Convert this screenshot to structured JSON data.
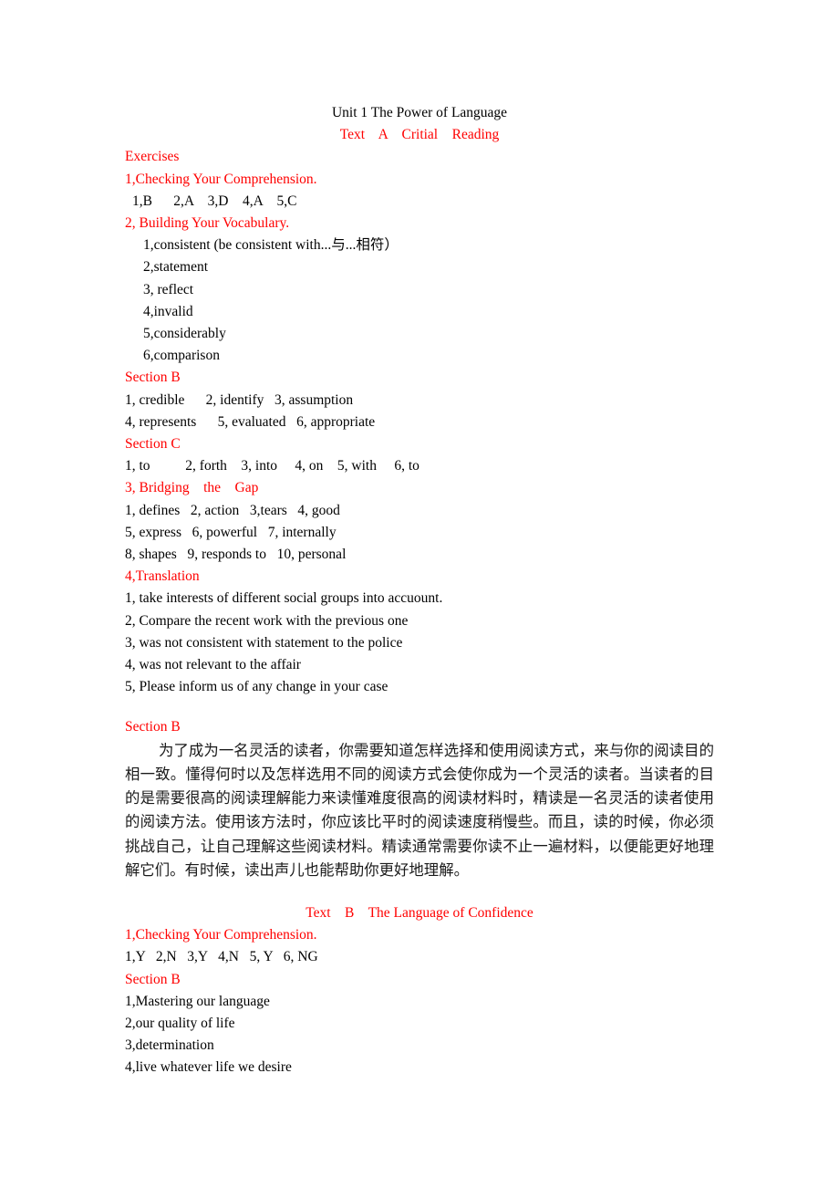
{
  "document": {
    "title": "Unit 1 The Power of Language",
    "subtitle": "Text    A    Critial    Reading",
    "colors": {
      "heading_red": "#ff0000",
      "body_black": "#000000",
      "page_background": "#ffffff"
    }
  },
  "text_a": {
    "exercises_heading": "Exercises",
    "section_1": {
      "heading": "1,Checking Your Comprehension.",
      "answers": "1,B      2,A    3,D    4,A    5,C"
    },
    "section_2": {
      "heading": "2, Building Your Vocabulary.",
      "items": [
        "1,consistent (be consistent with...与...相符）",
        "2,statement",
        "3, reflect",
        "4,invalid",
        "5,considerably",
        "6,comparison"
      ],
      "section_b_heading": "Section B",
      "section_b_lines": [
        "1, credible      2, identify   3, assumption",
        "4, represents      5, evaluated   6, appropriate"
      ],
      "section_c_heading": "Section C",
      "section_c_lines": [
        "1, to          2, forth    3, into     4, on    5, with     6, to"
      ]
    },
    "section_3": {
      "heading": "3, Bridging    the    Gap",
      "lines": [
        "1, defines   2, action   3,tears   4, good",
        "5, express   6, powerful   7, internally",
        "8, shapes   9, responds to   10, personal"
      ]
    },
    "section_4": {
      "heading": "4,Translation",
      "lines": [
        "1, take interests of different social groups into accuount.",
        "2, Compare the recent work with the previous one",
        "3, was not consistent with statement to the police",
        "4, was not relevant to the affair",
        "5, Please inform us of any change in your case"
      ]
    },
    "section_b_translation": {
      "heading": "Section B",
      "paragraph": "为了成为一名灵活的读者，你需要知道怎样选择和使用阅读方式，来与你的阅读目的相一致。懂得何时以及怎样选用不同的阅读方式会使你成为一个灵活的读者。当读者的目的是需要很高的阅读理解能力来读懂难度很高的阅读材料时，精读是一名灵活的读者使用的阅读方法。使用该方法时，你应该比平时的阅读速度稍慢些。而且，读的时候，你必须挑战自己，让自己理解这些阅读材料。精读通常需要你读不止一遍材料，以便能更好地理解它们。有时候，读出声儿也能帮助你更好地理解。"
    }
  },
  "text_b": {
    "title": "Text    B    The Language of Confidence",
    "section_1": {
      "heading": "1,Checking Your Comprehension.",
      "answers": "1,Y   2,N   3,Y   4,N   5, Y   6, NG"
    },
    "section_b": {
      "heading": "Section B",
      "items": [
        "1,Mastering our language",
        "2,our quality of life",
        "3,determination",
        "4,live whatever life we desire"
      ]
    }
  }
}
